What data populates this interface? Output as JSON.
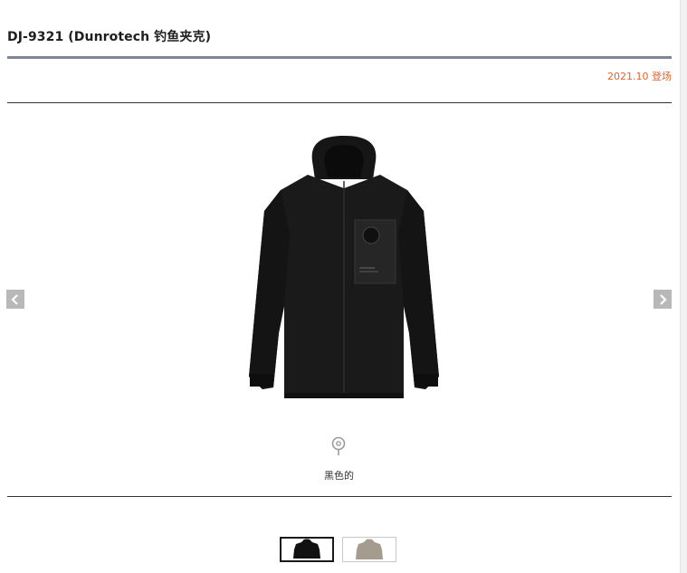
{
  "product": {
    "title": "DJ-9321 (Dunrotech 钓鱼夹克)",
    "release": "2021.10 登场"
  },
  "gallery": {
    "selected_color": "黑色的",
    "prev_icon": "chevron-left-icon",
    "next_icon": "chevron-right-icon",
    "zoom_icon": "zoom-pin-icon"
  },
  "swatches": [
    {
      "color_hex": "#111111"
    },
    {
      "color_hex": "#a59c90"
    }
  ],
  "colors": {
    "accent": "#e2622c",
    "title_rule": "#7b8794",
    "arrow_bg": "#b8b8b8"
  }
}
